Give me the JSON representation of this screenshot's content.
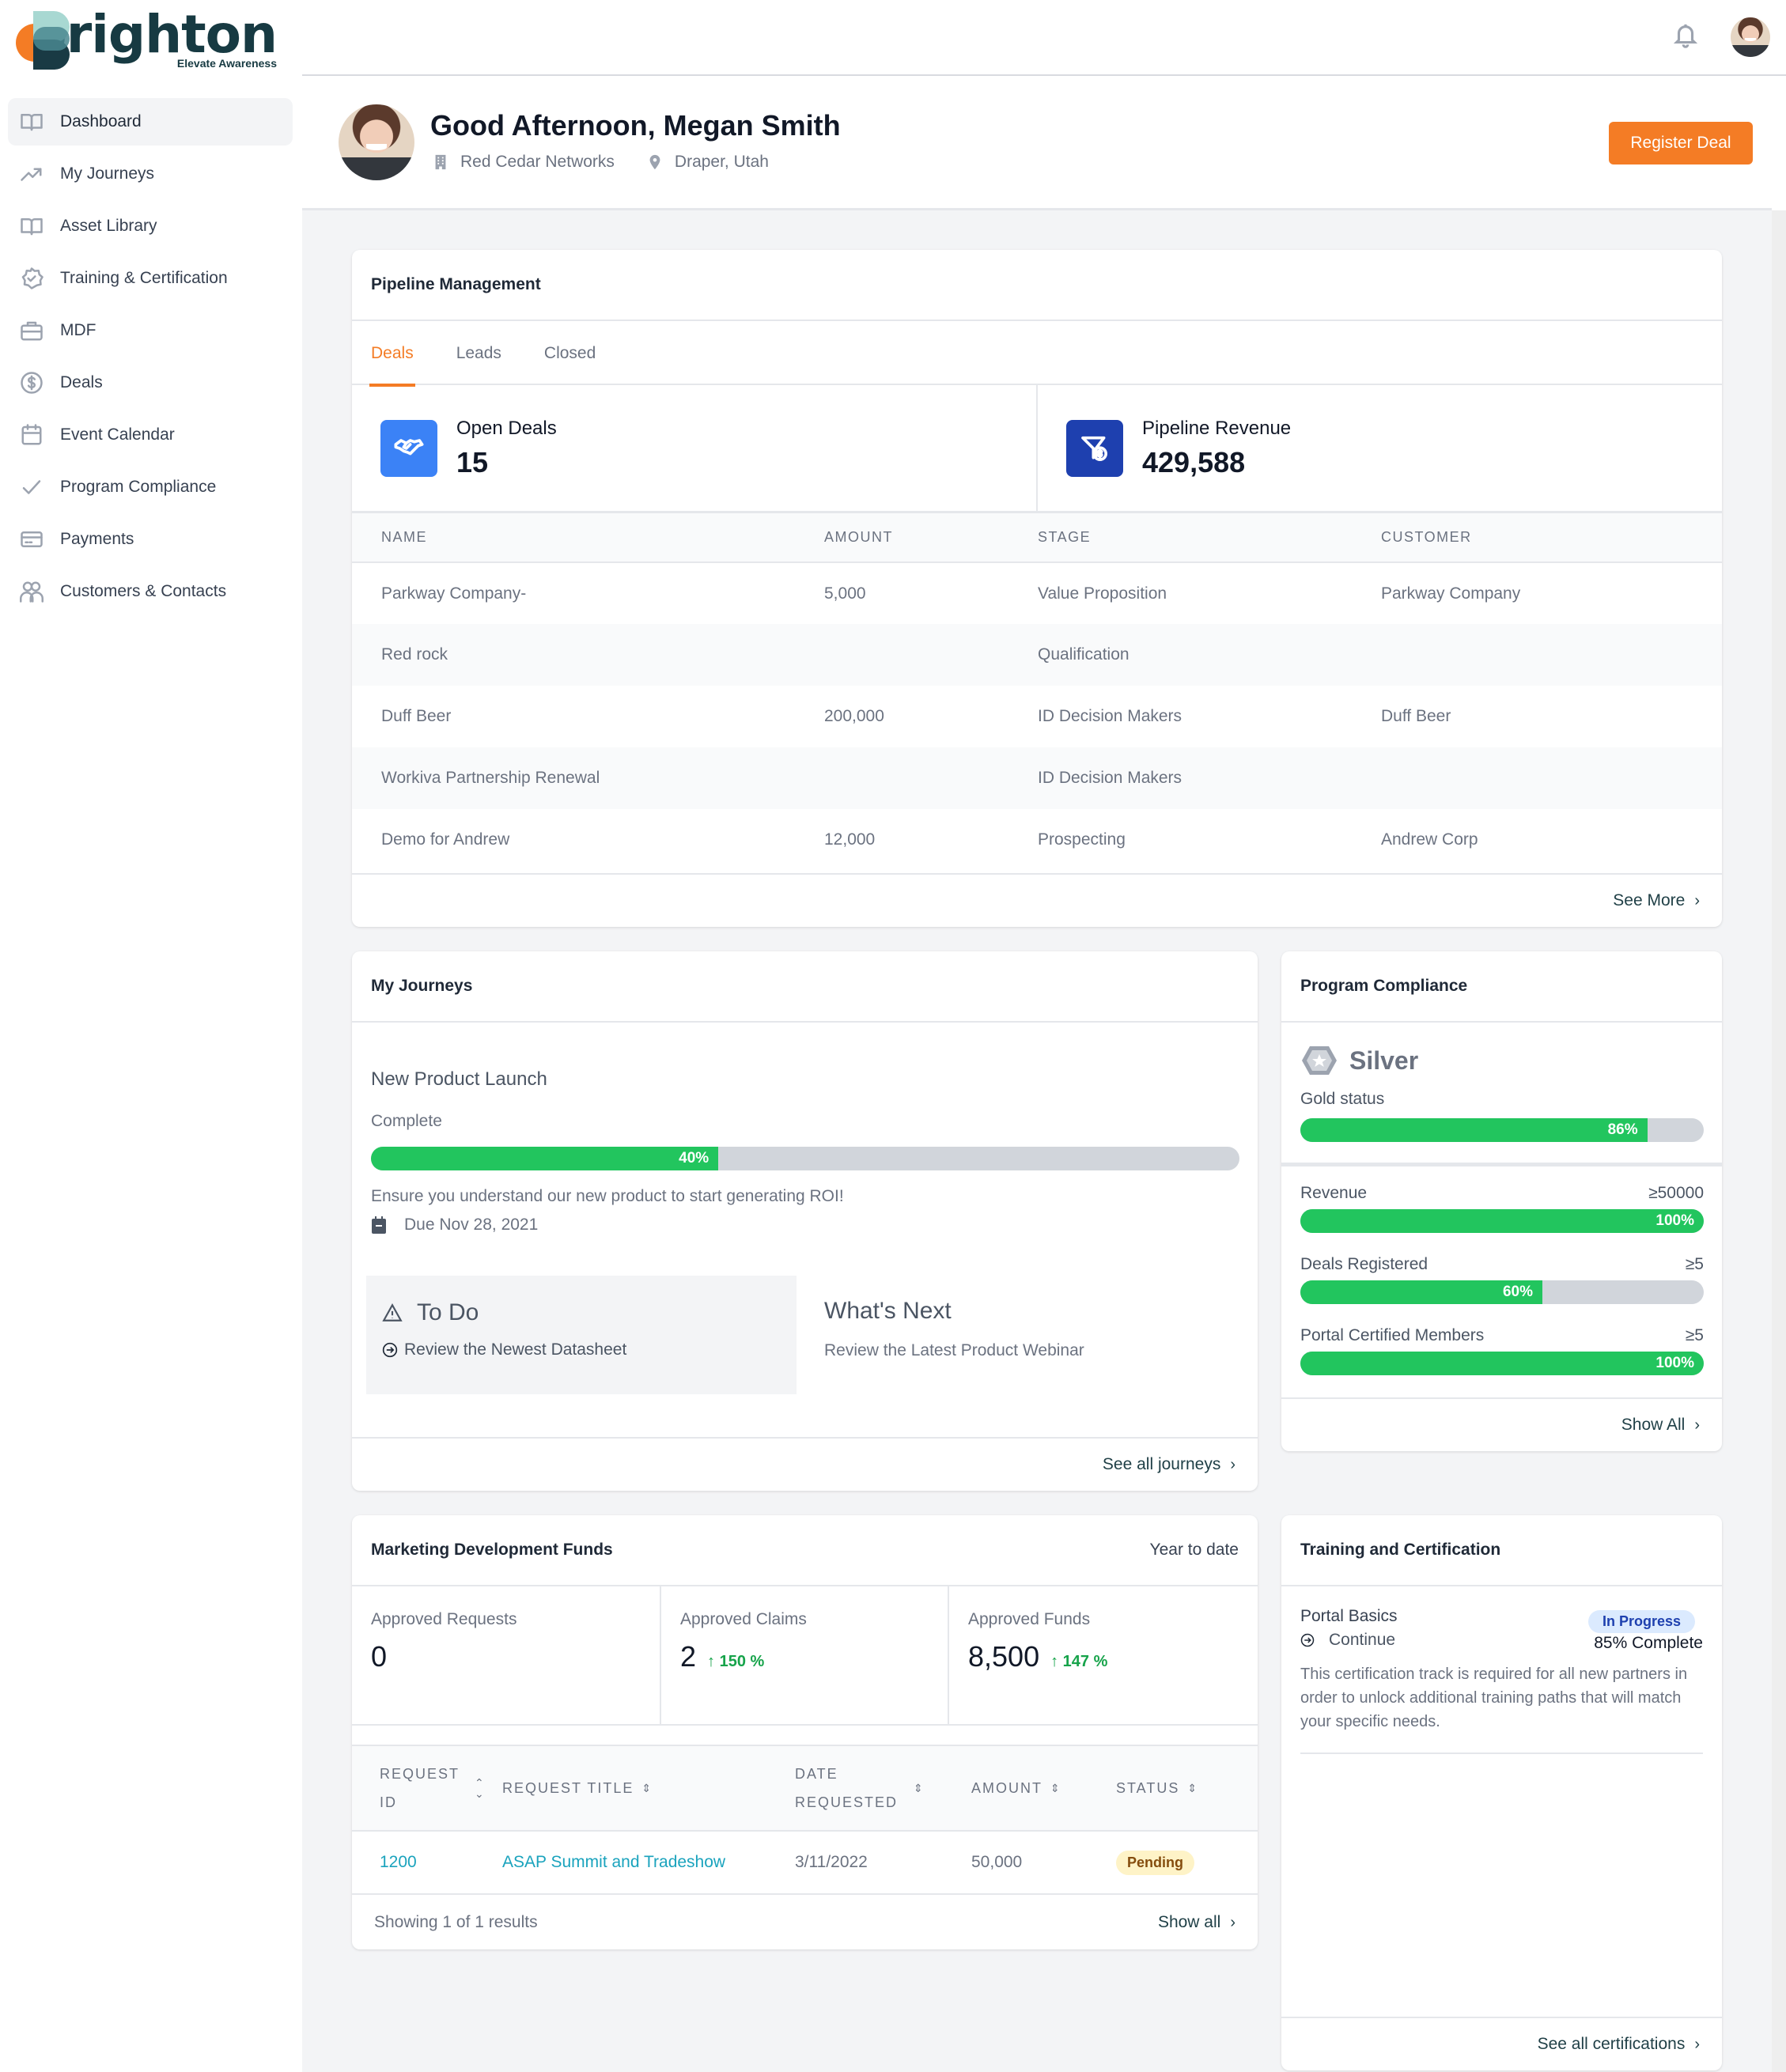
{
  "brand": {
    "name": "brighton",
    "tagline": "Elevate Awareness",
    "accent": "#f47c25"
  },
  "sidebar": {
    "items": [
      {
        "label": "Dashboard",
        "icon": "book-open-icon",
        "active": true
      },
      {
        "label": "My Journeys",
        "icon": "trending-up-icon"
      },
      {
        "label": "Asset Library",
        "icon": "book-open-icon"
      },
      {
        "label": "Training & Certification",
        "icon": "badge-check-icon"
      },
      {
        "label": "MDF",
        "icon": "briefcase-icon"
      },
      {
        "label": "Deals",
        "icon": "currency-dollar-icon"
      },
      {
        "label": "Event Calendar",
        "icon": "calendar-icon"
      },
      {
        "label": "Program Compliance",
        "icon": "check-icon"
      },
      {
        "label": "Payments",
        "icon": "credit-card-icon"
      },
      {
        "label": "Customers & Contacts",
        "icon": "users-icon"
      }
    ]
  },
  "header": {
    "greeting": "Good Afternoon, Megan Smith",
    "company": "Red Cedar Networks",
    "location": "Draper, Utah",
    "register_label": "Register Deal"
  },
  "pipeline": {
    "title": "Pipeline Management",
    "tabs": [
      "Deals",
      "Leads",
      "Closed"
    ],
    "active_tab": "Deals",
    "stats": [
      {
        "label": "Open Deals",
        "value": "15",
        "icon": "handshake-icon",
        "color": "#3b82f6"
      },
      {
        "label": "Pipeline Revenue",
        "value": "429,588",
        "icon": "funnel-dollar-icon",
        "color": "#1e40af"
      }
    ],
    "columns": [
      "NAME",
      "AMOUNT",
      "STAGE",
      "CUSTOMER"
    ],
    "rows": [
      [
        "Parkway Company-",
        "5,000",
        "Value Proposition",
        "Parkway Company"
      ],
      [
        "Red rock",
        "",
        "Qualification",
        ""
      ],
      [
        "Duff Beer",
        "200,000",
        "ID Decision Makers",
        "Duff Beer"
      ],
      [
        "Workiva Partnership Renewal",
        "",
        "ID Decision Makers",
        ""
      ],
      [
        "Demo for Andrew",
        "12,000",
        "Prospecting",
        "Andrew Corp"
      ]
    ],
    "see_more": "See More"
  },
  "journeys": {
    "title": "My Journeys",
    "name": "New Product Launch",
    "complete_label": "Complete",
    "progress": 40,
    "progress_label": "40%",
    "description": "Ensure you understand our new product to start generating ROI!",
    "due": "Due Nov 28, 2021",
    "todo_title": "To Do",
    "todo_item": "Review the Newest Datasheet",
    "next_title": "What's Next",
    "next_item": "Review the Latest Product Webinar",
    "see_all": "See all journeys"
  },
  "compliance": {
    "title": "Program Compliance",
    "tier": "Silver",
    "goal_label": "Gold status",
    "goal_progress": 86,
    "goal_progress_label": "86%",
    "requirements": [
      {
        "label": "Revenue",
        "target": "≥50000",
        "progress": 100,
        "progress_label": "100%"
      },
      {
        "label": "Deals Registered",
        "target": "≥5",
        "progress": 60,
        "progress_label": "60%"
      },
      {
        "label": "Portal Certified Members",
        "target": "≥5",
        "progress": 100,
        "progress_label": "100%"
      }
    ],
    "show_all": "Show All"
  },
  "mdf": {
    "title": "Marketing Development Funds",
    "range": "Year to date",
    "stats": [
      {
        "label": "Approved Requests",
        "value": "0",
        "change": ""
      },
      {
        "label": "Approved Claims",
        "value": "2",
        "change": "↑ 150 %"
      },
      {
        "label": "Approved Funds",
        "value": "8,500",
        "change": "↑ 147 %"
      }
    ],
    "columns": [
      "REQUEST ID",
      "REQUEST TITLE",
      "DATE REQUESTED",
      "AMOUNT",
      "STATUS"
    ],
    "rows": [
      {
        "id": "1200",
        "title": "ASAP Summit and Tradeshow",
        "date": "3/11/2022",
        "amount": "50,000",
        "status": "Pending"
      }
    ],
    "showing": "Showing 1 of 1 results",
    "show_all": "Show all"
  },
  "training": {
    "title": "Training and Certification",
    "course": "Portal Basics",
    "continue_label": "Continue",
    "status": "In Progress",
    "percent": "85% Complete",
    "description": "This certification track is required for all new partners in order to unlock additional training paths that will match your specific needs.",
    "see_all": "See all certifications"
  }
}
